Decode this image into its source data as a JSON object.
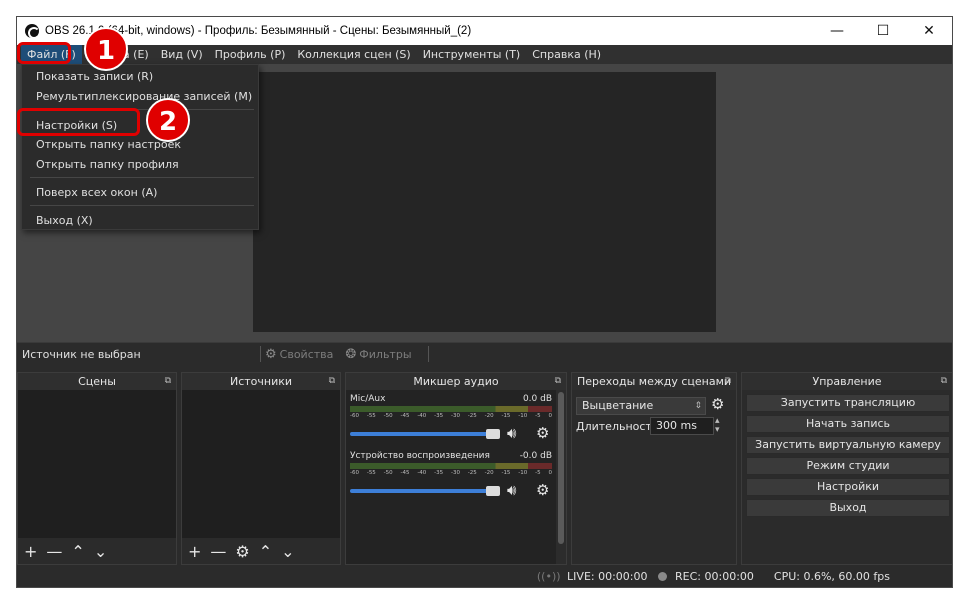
{
  "window": {
    "title": "OBS 26.1.0 (64-bit, windows) - Профиль: Безымянный - Сцены: Безымянный_(2)",
    "minimize_glyph": "—",
    "maximize_glyph": "☐",
    "close_glyph": "✕"
  },
  "menubar": {
    "items": [
      {
        "label": "Файл (F)"
      },
      {
        "label": "Правка (E)"
      },
      {
        "label": "Вид (V)"
      },
      {
        "label": "Профиль (P)"
      },
      {
        "label": "Коллекция сцен (S)"
      },
      {
        "label": "Инструменты (T)"
      },
      {
        "label": "Справка (H)"
      }
    ]
  },
  "file_menu": {
    "items": [
      {
        "label": "Показать записи (R)"
      },
      {
        "label": "Ремультиплексирование записей (M)"
      },
      {
        "label": "Настройки (S)"
      },
      {
        "label": "Открыть папку настроек"
      },
      {
        "label": "Открыть папку профиля"
      },
      {
        "label": "Поверх всех окон (A)"
      },
      {
        "label": "Выход (X)"
      }
    ]
  },
  "source_toolbar": {
    "no_source": "Источник не выбран",
    "properties": "Свойства",
    "filters": "Фильтры"
  },
  "scenes": {
    "title": "Сцены"
  },
  "sources": {
    "title": "Источники"
  },
  "mixer": {
    "title": "Микшер аудио",
    "channels": [
      {
        "name": "Mic/Aux",
        "db": "0.0 dB"
      },
      {
        "name": "Устройство воспроизведения",
        "db": "-0.0 dB"
      }
    ],
    "ticks": [
      "-60",
      "-55",
      "-50",
      "-45",
      "-40",
      "-35",
      "-30",
      "-25",
      "-20",
      "-15",
      "-10",
      "-5",
      "0"
    ]
  },
  "transitions": {
    "title": "Переходы между сценами",
    "selected": "Выцветание",
    "duration_label": "Длительность",
    "duration_value": "300 ms"
  },
  "controls": {
    "title": "Управление",
    "buttons": [
      {
        "label": "Запустить трансляцию"
      },
      {
        "label": "Начать запись"
      },
      {
        "label": "Запустить виртуальную камеру"
      },
      {
        "label": "Режим студии"
      },
      {
        "label": "Настройки"
      },
      {
        "label": "Выход"
      }
    ]
  },
  "status": {
    "live": "LIVE: 00:00:00",
    "rec": "REC: 00:00:00",
    "cpu": "CPU: 0.6%, 60.00 fps"
  },
  "annotations": {
    "badge1": "1",
    "badge2": "2"
  },
  "colors": {
    "highlight": "#e00000",
    "menu_active": "#1e4d78",
    "fader": "#3d7fd8"
  }
}
